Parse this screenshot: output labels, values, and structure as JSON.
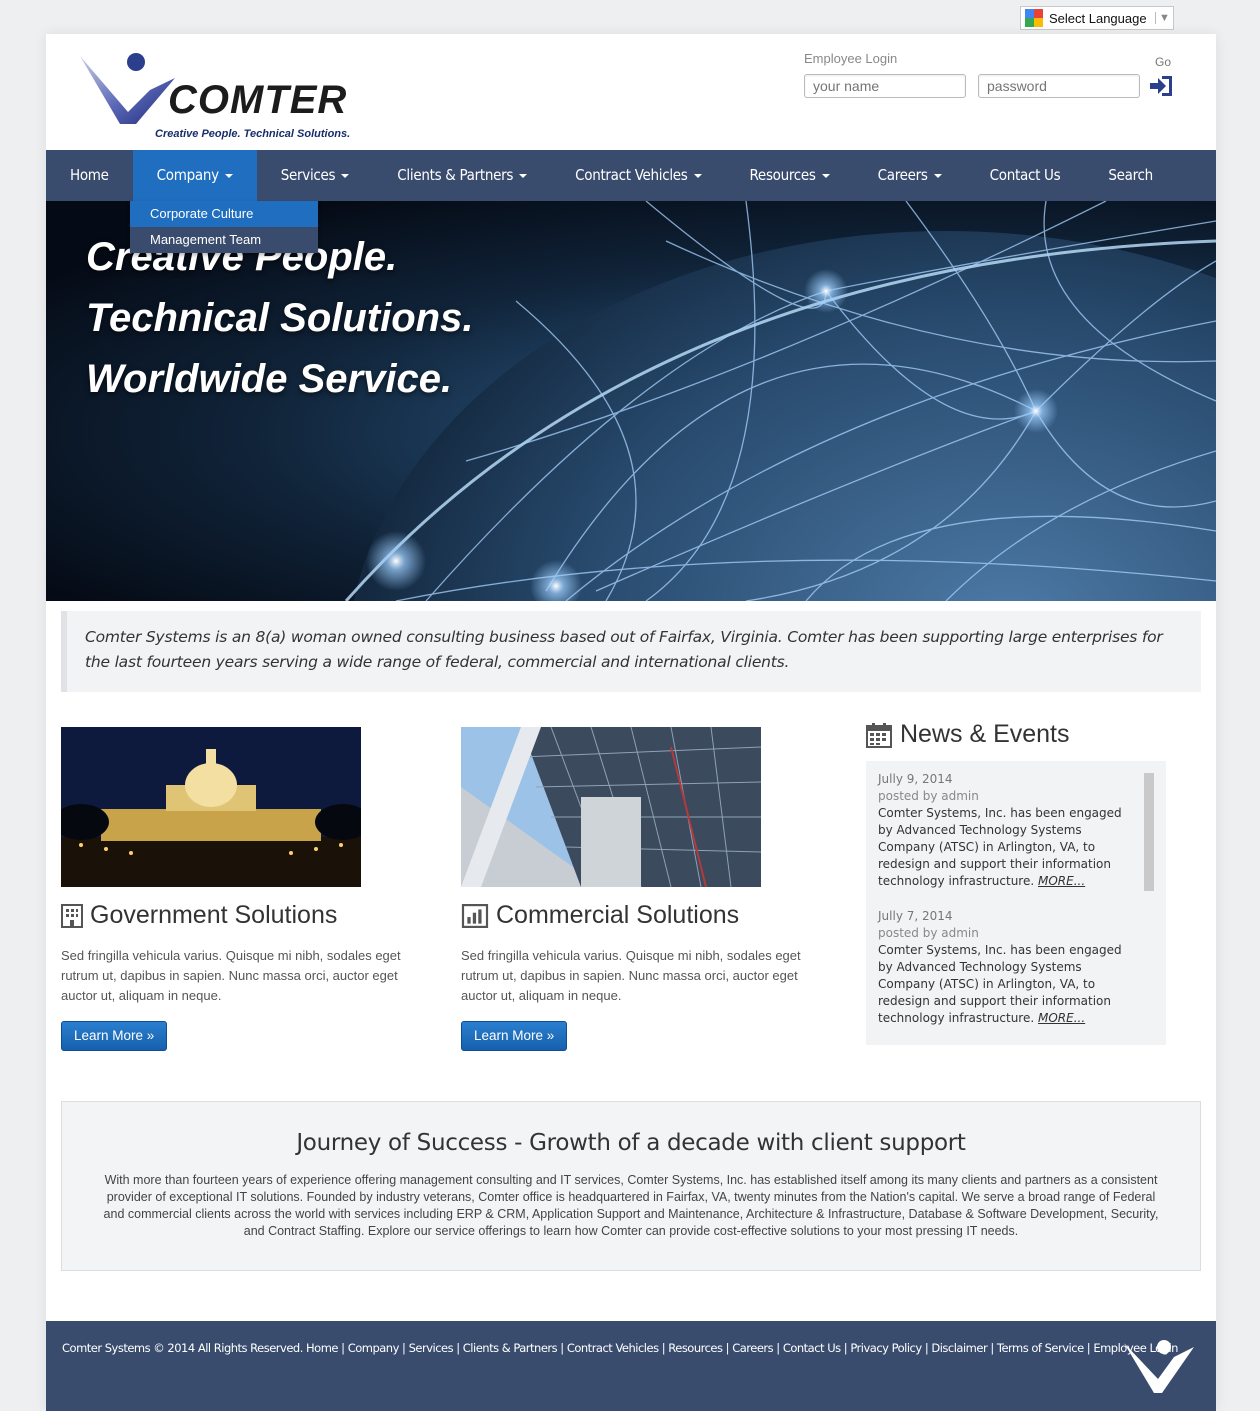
{
  "language": {
    "label": "Select Language"
  },
  "header": {
    "brand": "COMTER",
    "tagline": "Creative People. Technical Solutions.",
    "login_label": "Employee Login",
    "go_label": "Go",
    "name_placeholder": "your name",
    "password_placeholder": "password"
  },
  "nav": {
    "items": [
      {
        "label": "Home"
      },
      {
        "label": "Company"
      },
      {
        "label": "Services"
      },
      {
        "label": "Clients & Partners"
      },
      {
        "label": "Contract Vehicles"
      },
      {
        "label": "Resources"
      },
      {
        "label": "Careers"
      },
      {
        "label": "Contact Us"
      },
      {
        "label": "Search"
      }
    ],
    "dropdown": [
      "Corporate Culture",
      "Management Team"
    ]
  },
  "hero": {
    "line1": "Creative People.",
    "line2": "Technical Solutions.",
    "line3": "Worldwide Service."
  },
  "intro": "Comter Systems is an 8(a) woman owned consulting business based out of Fairfax, Virginia. Comter has been supporting large enterprises for the last fourteen years serving a wide range of federal, commercial and international clients.",
  "solutions": [
    {
      "title": "Government Solutions",
      "text": "Sed fringilla vehicula varius. Quisque mi nibh, sodales eget rutrum ut, dapibus in sapien. Nunc massa orci, auctor eget auctor ut, aliquam in neque.",
      "button": "Learn More »"
    },
    {
      "title": "Commercial Solutions",
      "text": "Sed fringilla vehicula varius. Quisque mi nibh, sodales eget rutrum ut, dapibus in sapien. Nunc massa orci, auctor eget auctor ut, aliquam in neque.",
      "button": "Learn More »"
    }
  ],
  "news": {
    "title": "News & Events",
    "items": [
      {
        "date": "Jully 9, 2014",
        "by": "posted by admin",
        "body": "Comter Systems, Inc. has been engaged by Advanced Technology Systems Company (ATSC) in Arlington, VA, to redesign and support their information technology infrastructure. ",
        "more": "MORE..."
      },
      {
        "date": "Jully 7, 2014",
        "by": "posted by admin",
        "body": "Comter Systems, Inc. has been engaged by Advanced Technology Systems Company (ATSC) in Arlington, VA, to redesign and support their information technology infrastructure. ",
        "more": "MORE..."
      }
    ]
  },
  "journey": {
    "title": "Journey of Success - Growth of a decade with client support",
    "text": "With more than fourteen years of experience offering management consulting and IT services, Comter Systems, Inc. has established itself among its many clients and partners as a consistent provider of exceptional IT solutions. Founded by industry veterans, Comter office is headquartered in Fairfax, VA, twenty minutes from the Nation's capital. We serve a broad range of Federal and commercial clients across the world with services including ERP & CRM, Application Support and Maintenance, Architecture & Infrastructure, Database & Software Development, Security, and Contract Staffing. Explore our service offerings to learn how Comter can provide cost-effective solutions to your most pressing IT needs."
  },
  "footer": {
    "copyright": "Comter Systems © 2014 All Rights Reserved.",
    "links": [
      "Home",
      "Company",
      "Services",
      "Clients & Partners",
      "Contract Vehicles",
      "Resources",
      "Careers",
      "Contact Us",
      "Privacy Policy",
      "Disclaimer",
      "Terms of Service",
      "Employee Login"
    ]
  },
  "colors": {
    "nav": "#3a4c6e",
    "accent": "#1f6ec0",
    "brand_blue": "#2b3f8c"
  }
}
